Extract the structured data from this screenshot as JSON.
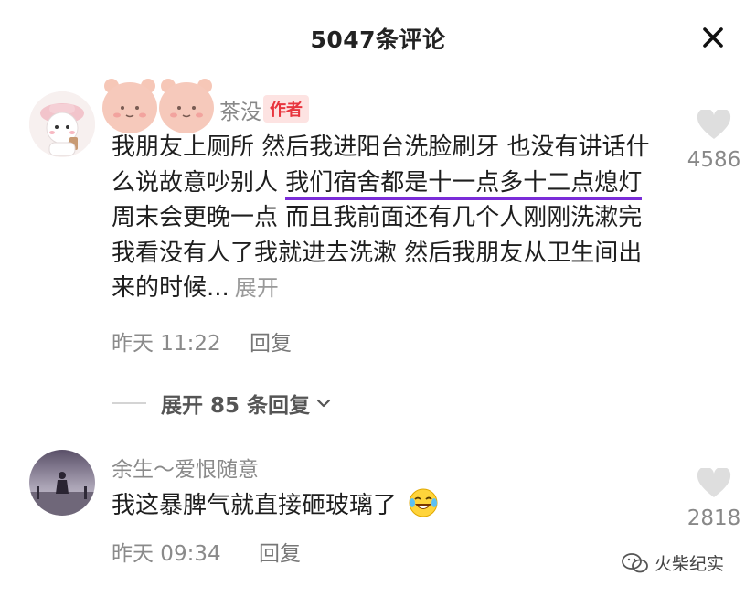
{
  "header": {
    "title": "5047条评论"
  },
  "comment1": {
    "username_visible": "茶没",
    "badge": "作者",
    "text_before": "我朋友上厕所 然后我进阳台洗脸刷牙 也没有讲话什么说故意吵别人 ",
    "text_underlined": "我们宿舍都是十一点多十二点熄灯",
    "text_after": " 周末会更晚一点 而且我前面还有几个人刚刚洗漱完 我看没有人了我就进去洗漱 然后我朋友从卫生间出来的时候...",
    "expand_label": "展开",
    "time": "昨天 11:22",
    "reply_label": "回复",
    "likes": "4586",
    "more_replies_label": "展开 85 条回复"
  },
  "comment2": {
    "username": "余生～爱恨随意",
    "text": "我这暴脾气就直接砸玻璃了",
    "time": "昨天 09:34",
    "reply_label": "回复",
    "likes": "2818"
  },
  "watermark": {
    "text": "火柴纪实"
  },
  "colors": {
    "accent_underline": "#7a2cd8",
    "badge_text": "#e8353e",
    "badge_bg": "#fde3e2"
  },
  "icons": {
    "close": "close-icon",
    "like": "heart-icon",
    "chevron": "chevron-down-icon",
    "emoji": "laughing-crying-emoji-icon",
    "watermark": "wechat-logo-icon"
  }
}
